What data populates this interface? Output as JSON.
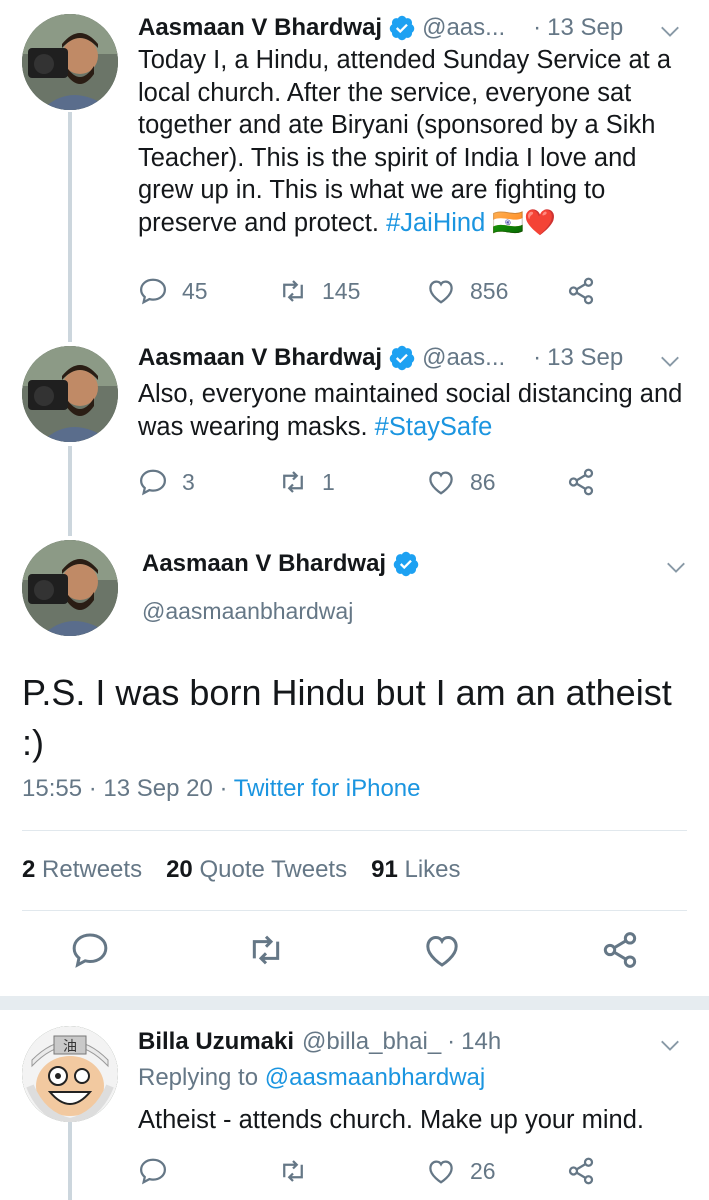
{
  "colors": {
    "accent": "#1b95e0",
    "muted": "#657786",
    "heart": "#e0245e",
    "line": "#ccd6dd"
  },
  "tweet1": {
    "name": "Aasmaan V Bhardwaj",
    "handle": "@aas...",
    "date": "13 Sep",
    "text": "Today I, a Hindu, attended Sunday Service at a local church. After the service, everyone sat together and ate Biryani (sponsored by a Sikh Teacher). This is the spirit of India I love and grew up in. This is what we are fighting to preserve and protect.",
    "hashtag": "#JaiHind",
    "emoji": "🇮🇳❤️",
    "replies": "45",
    "retweets": "145",
    "likes": "856"
  },
  "tweet2": {
    "name": "Aasmaan V Bhardwaj",
    "handle": "@aas...",
    "date": "13 Sep",
    "text": "Also, everyone maintained social distancing and was wearing masks.",
    "hashtag": "#StaySafe",
    "replies": "3",
    "retweets": "1",
    "likes": "86"
  },
  "main": {
    "name": "Aasmaan V Bhardwaj",
    "handle": "@aasmaanbhardwaj",
    "text": "P.S. I was born Hindu but I am an atheist :)",
    "time": "15:55",
    "date": "13 Sep 20",
    "source": "Twitter for iPhone",
    "retweet_count": "2",
    "retweet_label": "Retweets",
    "quote_count": "20",
    "quote_label": "Quote Tweets",
    "like_count": "91",
    "like_label": "Likes"
  },
  "reply": {
    "name": "Billa Uzumaki",
    "handle": "@billa_bhai_",
    "time": "14h",
    "replying_prefix": "Replying to",
    "replying_handle": "@aasmaanbhardwaj",
    "text": "Atheist  - attends church. Make up your mind.",
    "replies": "",
    "retweets": "",
    "likes": "26"
  },
  "separator": "·"
}
